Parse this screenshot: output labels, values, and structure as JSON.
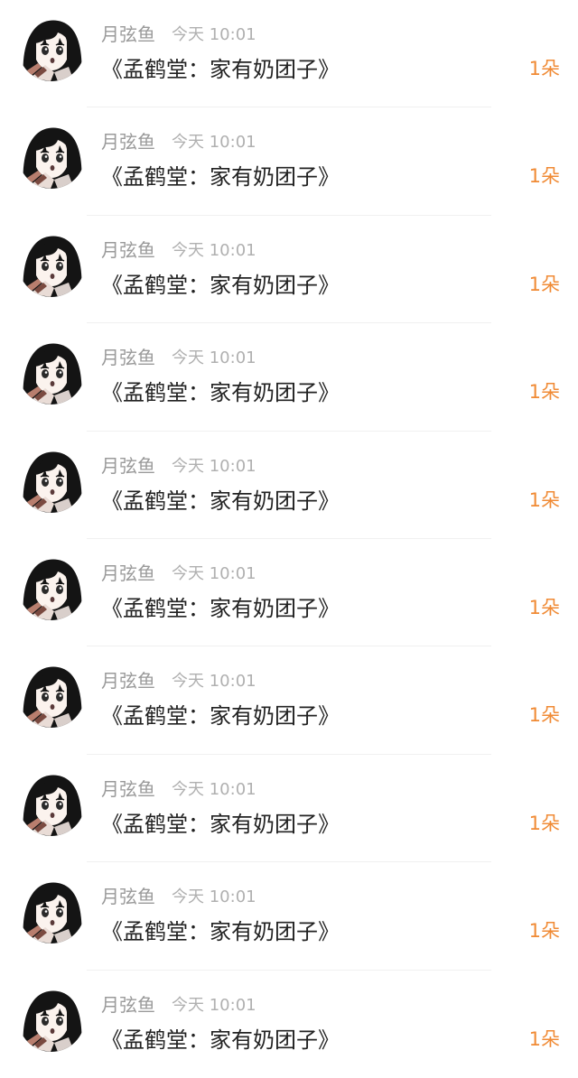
{
  "colors": {
    "username": "#9a9a9a",
    "timestamp": "#b0b0b0",
    "message": "#222222",
    "count_accent": "#f08a34",
    "divider": "#f0f0f0"
  },
  "items": [
    {
      "avatar_icon": "anime-avatar-icon",
      "username": "月弦鱼",
      "time": "今天 10:01",
      "message": "《孟鹤堂：家有奶团子》",
      "count": "1朵"
    },
    {
      "avatar_icon": "anime-avatar-icon",
      "username": "月弦鱼",
      "time": "今天 10:01",
      "message": "《孟鹤堂：家有奶团子》",
      "count": "1朵"
    },
    {
      "avatar_icon": "anime-avatar-icon",
      "username": "月弦鱼",
      "time": "今天 10:01",
      "message": "《孟鹤堂：家有奶团子》",
      "count": "1朵"
    },
    {
      "avatar_icon": "anime-avatar-icon",
      "username": "月弦鱼",
      "time": "今天 10:01",
      "message": "《孟鹤堂：家有奶团子》",
      "count": "1朵"
    },
    {
      "avatar_icon": "anime-avatar-icon",
      "username": "月弦鱼",
      "time": "今天 10:01",
      "message": "《孟鹤堂：家有奶团子》",
      "count": "1朵"
    },
    {
      "avatar_icon": "anime-avatar-icon",
      "username": "月弦鱼",
      "time": "今天 10:01",
      "message": "《孟鹤堂：家有奶团子》",
      "count": "1朵"
    },
    {
      "avatar_icon": "anime-avatar-icon",
      "username": "月弦鱼",
      "time": "今天 10:01",
      "message": "《孟鹤堂：家有奶团子》",
      "count": "1朵"
    },
    {
      "avatar_icon": "anime-avatar-icon",
      "username": "月弦鱼",
      "time": "今天 10:01",
      "message": "《孟鹤堂：家有奶团子》",
      "count": "1朵"
    },
    {
      "avatar_icon": "anime-avatar-icon",
      "username": "月弦鱼",
      "time": "今天 10:01",
      "message": "《孟鹤堂：家有奶团子》",
      "count": "1朵"
    },
    {
      "avatar_icon": "anime-avatar-icon",
      "username": "月弦鱼",
      "time": "今天 10:01",
      "message": "《孟鹤堂：家有奶团子》",
      "count": "1朵"
    }
  ]
}
